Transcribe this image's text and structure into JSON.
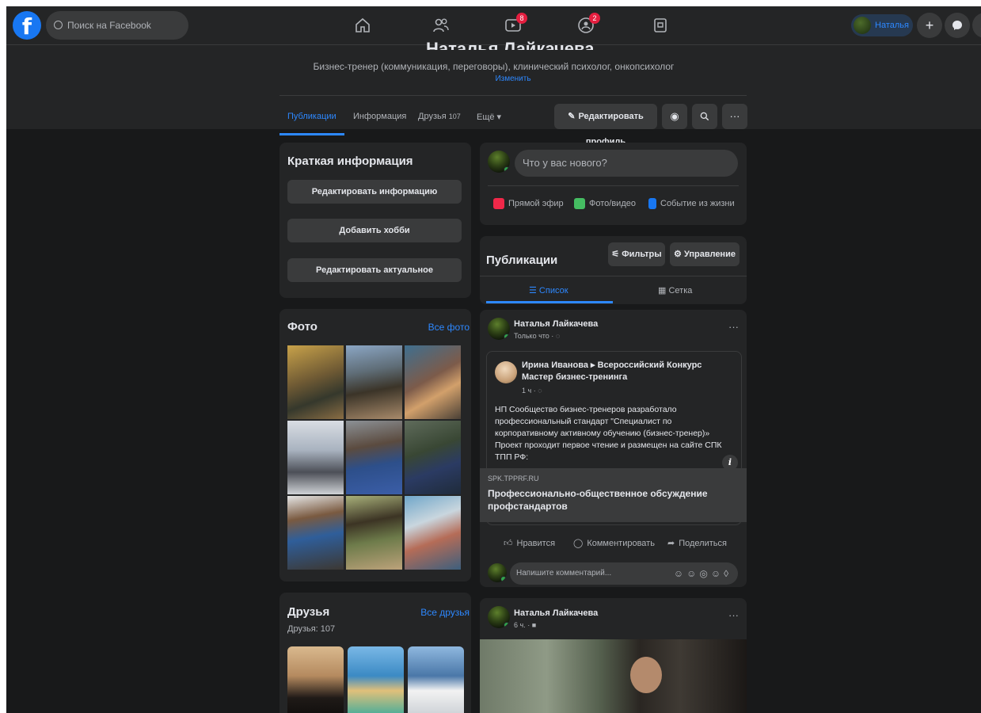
{
  "topbar": {
    "search_placeholder": "Поиск на Facebook",
    "video_badge": "8",
    "groups_badge": "2",
    "user_name": "Наталья"
  },
  "profile": {
    "name": "Наталья Лайкачева",
    "bio": "Бизнес-тренер (коммуникация, переговоры), клинический психолог, онкопсихолог",
    "edit_bio": "Изменить",
    "tabs": [
      {
        "label": "Публикации"
      },
      {
        "label": "Информация"
      },
      {
        "label": "Друзья"
      },
      {
        "label": "Ещё ▾"
      }
    ],
    "friends_count": "107",
    "edit_profile_label": "Редактировать профиль"
  },
  "intro": {
    "title": "Краткая информация",
    "buttons": [
      "Редактировать информацию",
      "Добавить хобби",
      "Редактировать актуальное"
    ]
  },
  "photos": {
    "title": "Фото",
    "link": "Все фото"
  },
  "friends": {
    "title": "Друзья",
    "link": "Все друзья",
    "count_label": "Друзья: 107"
  },
  "composer": {
    "placeholder": "Что у вас нового?",
    "actions": [
      "Прямой эфир",
      "Фото/видео",
      "Событие из жизни"
    ]
  },
  "publications": {
    "title": "Публикации",
    "filters_label": "Фильтры",
    "manage_label": "Управление",
    "list_label": "Список",
    "grid_label": "Сетка"
  },
  "post1": {
    "author": "Наталья Лайкачева",
    "time": "Только что ·",
    "shared_author": "Ирина Иванова ▸ Всероссийский Конкурс Мастер бизнес-тренинга",
    "shared_time": "1 ч ·",
    "shared_text": "НП Сообщество бизнес-тренеров разработало профессиональный стандарт \"Специалист по корпоративному активному обучению (бизнес-тренер)» Проект проходит первое чтение и размещен на сайте СПК ТПП РФ:",
    "link_domain": "SPK.TPPRF.RU",
    "link_title": "Профессионально-общественное обсуждение профстандартов",
    "like": "Нравится",
    "comment": "Комментировать",
    "share": "Поделиться",
    "comment_placeholder": "Напишите комментарий..."
  },
  "post2": {
    "author": "Наталья Лайкачева",
    "time": "6 ч. ·"
  },
  "colors": {
    "background": "#18191a",
    "card": "#242526",
    "accent": "#2d88ff",
    "button": "#3a3b3c"
  }
}
